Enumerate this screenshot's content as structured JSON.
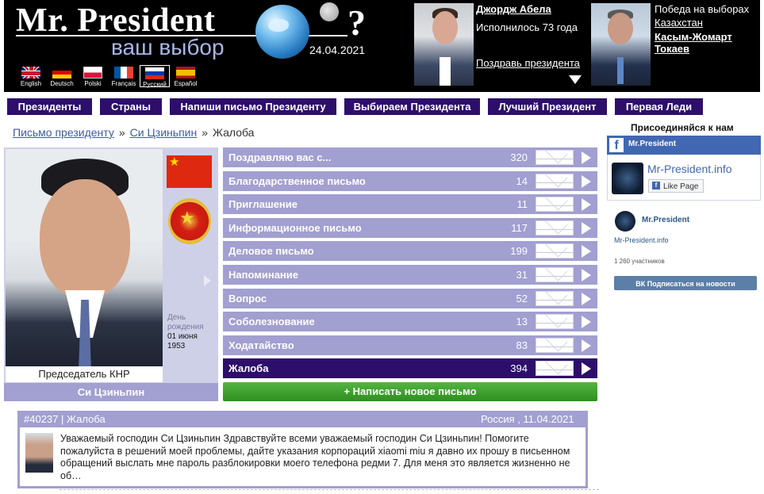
{
  "header": {
    "logo_title": "Mr. President",
    "logo_subtitle": "ваш выбор",
    "question_mark": "?",
    "date": "24.04.2021",
    "languages": [
      {
        "code": "English",
        "flag": "uk-flag"
      },
      {
        "code": "Deutsch",
        "flag": "de-flag"
      },
      {
        "code": "Polski",
        "flag": "pl-flag"
      },
      {
        "code": "Français",
        "flag": "fr-flag"
      },
      {
        "code": "Русский",
        "flag": "ru-flag",
        "active": true
      },
      {
        "code": "Español",
        "flag": "es-flag"
      }
    ],
    "birthday": {
      "name": "Джордж Абела",
      "line": "Исполнилось 73 года",
      "link": "Поздравь президента"
    },
    "election": {
      "line1": "Победа на выборах",
      "country": "Казахстан",
      "name": "Касым-Жомарт Токаев"
    }
  },
  "nav": [
    "Президенты",
    "Страны",
    "Напиши письмо Президенту",
    "Выбираем Президента",
    "Лучший Президент",
    "Первая Леди"
  ],
  "breadcrumbs": {
    "item1": "Письмо президенту",
    "item2": "Си Цзиньпин",
    "current": "Жалоба",
    "separator": "»"
  },
  "president": {
    "caption": "Председатель КНР",
    "name": "Си Цзиньпин",
    "birthday_label": "День рождения",
    "birthday_date": "01 июня 1953"
  },
  "categories": [
    {
      "label": "Поздравляю вас с...",
      "count": "320"
    },
    {
      "label": "Благодарственное письмо",
      "count": "14"
    },
    {
      "label": "Приглашение",
      "count": "11"
    },
    {
      "label": "Информационное письмо",
      "count": "117"
    },
    {
      "label": "Деловое письмо",
      "count": "199"
    },
    {
      "label": "Напоминание",
      "count": "31"
    },
    {
      "label": "Вопрос",
      "count": "52"
    },
    {
      "label": "Соболезнование",
      "count": "13"
    },
    {
      "label": "Ходатайство",
      "count": "83"
    },
    {
      "label": "Жалоба",
      "count": "394",
      "active": true
    }
  ],
  "write_button": "+ Написать новое письмо",
  "social": {
    "join": "Присоединяйся к нам",
    "fb_title": "Mr.President",
    "fb_site": "Mr-President.info",
    "fb_like": "Like Page",
    "vk_name": "Mr.President",
    "vk_site": "Mr-President.info",
    "vk_members": "1 260 участников",
    "vk_button": "Подписаться на новости"
  },
  "letter": {
    "header_left": "#40237 | Жалоба",
    "header_right": "Россия , 11.04.2021",
    "text": "Уважаемый господин Си Цзиньпин Здравствуйте всеми уважаемый господин Си Цзиньпин! Помогите пожалуйста в решений моей проблемы, дайте указания корпораций xiaomi miu я давно их прошу в письенном обращений выслать мне пароль разблокировки моего телефона редми 7. Для меня это является жизненно не об…"
  },
  "colors": {
    "header_bg": "#000000",
    "nav_bg": "#2d0f6b",
    "category_bg": "#a29fd1",
    "category_active": "#2d0f6b",
    "green_button": "#3b9e2c",
    "link": "#3d5aa8"
  }
}
